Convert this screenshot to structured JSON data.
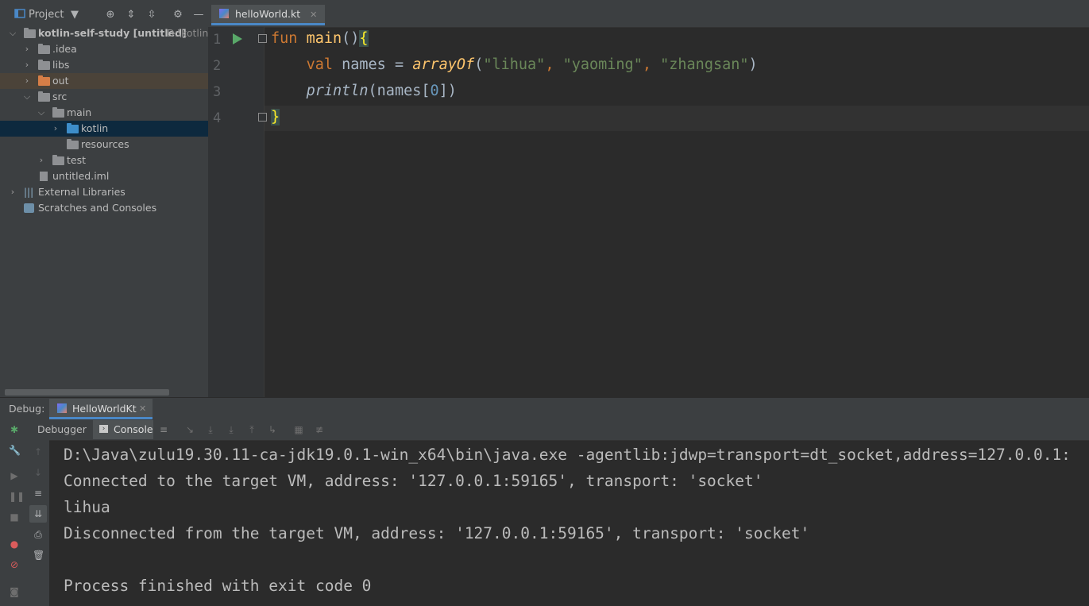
{
  "project_panel": {
    "title": "Project",
    "tree": [
      {
        "label": "kotlin-self-study [untitled]",
        "path_hint": "D:\\kotlin-"
      },
      {
        "label": ".idea"
      },
      {
        "label": "libs"
      },
      {
        "label": "out"
      },
      {
        "label": "src"
      },
      {
        "label": "main"
      },
      {
        "label": "kotlin"
      },
      {
        "label": "resources"
      },
      {
        "label": "test"
      },
      {
        "label": "untitled.iml"
      },
      {
        "label": "External Libraries"
      },
      {
        "label": "Scratches and Consoles"
      }
    ]
  },
  "editor": {
    "tab": "helloWorld.kt",
    "line_numbers": [
      "1",
      "2",
      "3",
      "4"
    ],
    "code": {
      "l1_kw": "fun",
      "l1_fn": "main",
      "l1_rest": "()",
      "l1_brace": "{",
      "l2_kw": "val",
      "l2_mid": " names = ",
      "l2_fn": "arrayOf",
      "l2_open": "(",
      "l2_s1": "\"lihua\"",
      "l2_c1": ", ",
      "l2_s2": "\"yaoming\"",
      "l2_c2": ", ",
      "l2_s3": "\"zhangsan\"",
      "l2_close": ")",
      "l3_fn": "println",
      "l3_a": "(names[",
      "l3_num": "0",
      "l3_b": "])",
      "l4_brace": "}"
    }
  },
  "debug": {
    "label": "Debug:",
    "config_tab": "HelloWorldKt",
    "tab_debugger": "Debugger",
    "tab_console": "Console",
    "console_lines": [
      "D:\\Java\\zulu19.30.11-ca-jdk19.0.1-win_x64\\bin\\java.exe -agentlib:jdwp=transport=dt_socket,address=127.0.0.1:",
      "Connected to the target VM, address: '127.0.0.1:59165', transport: 'socket'",
      "lihua",
      "Disconnected from the target VM, address: '127.0.0.1:59165', transport: 'socket'",
      "",
      "Process finished with exit code 0"
    ]
  }
}
